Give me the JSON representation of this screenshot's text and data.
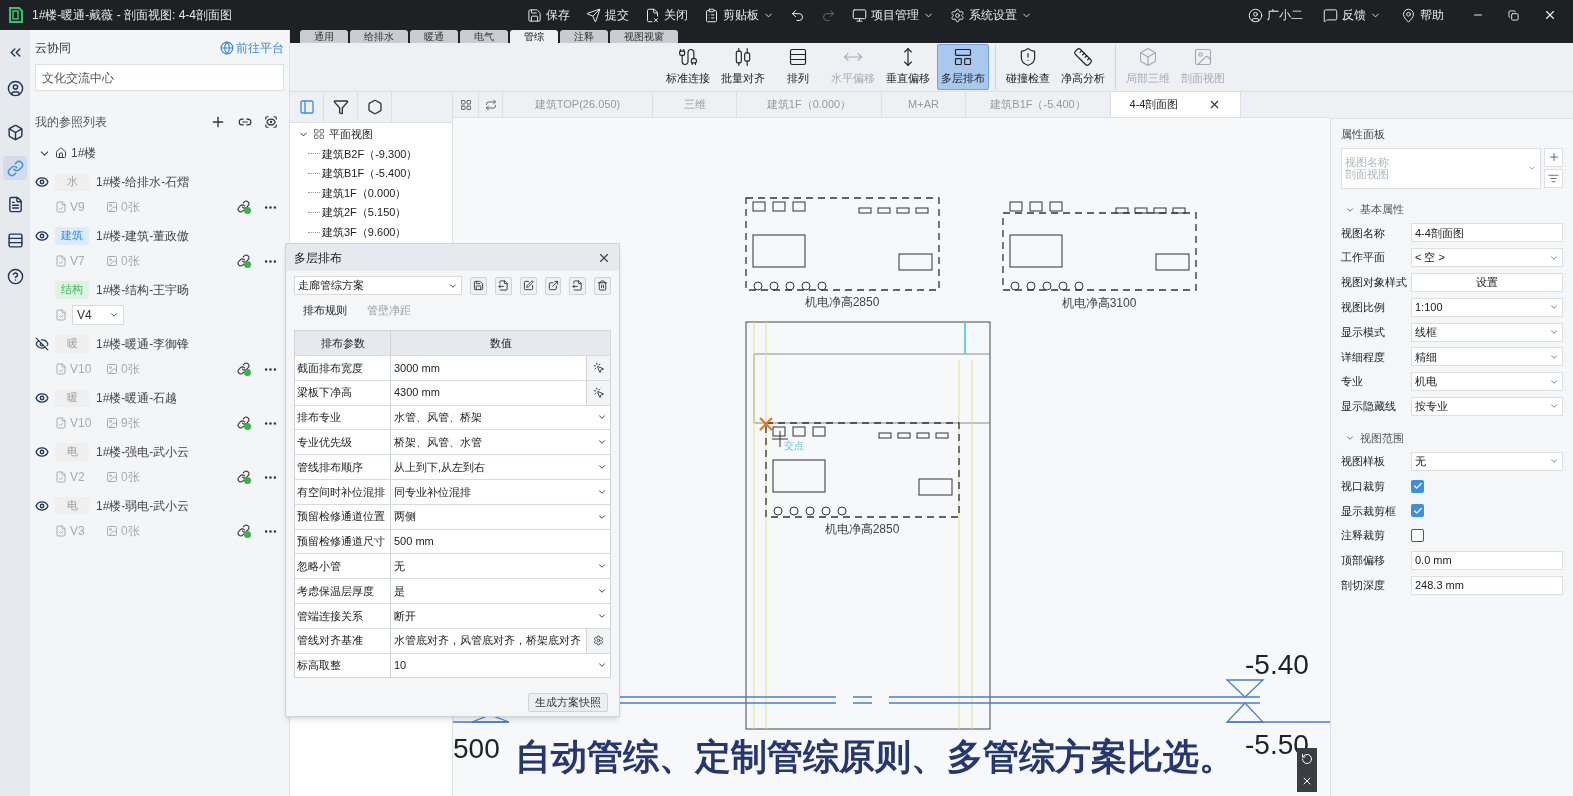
{
  "title_bar": {
    "title": "1#楼-暖通-戴薇 - 剖面视图: 4-4剖面图",
    "tools": [
      {
        "kind": "save",
        "label": "保存",
        "menu": false,
        "disabled": false
      },
      {
        "kind": "submit",
        "label": "提交",
        "menu": false,
        "disabled": false
      },
      {
        "kind": "close",
        "label": "关闭",
        "menu": false,
        "disabled": false
      },
      {
        "kind": "clipboard",
        "label": "剪贴板",
        "menu": true,
        "disabled": false
      },
      {
        "kind": "undo",
        "menu": false,
        "disabled": false
      },
      {
        "kind": "redo",
        "menu": false,
        "disabled": true
      },
      {
        "kind": "project",
        "label": "项目管理",
        "menu": true,
        "disabled": false
      },
      {
        "kind": "settings",
        "label": "系统设置",
        "menu": true,
        "disabled": false
      }
    ],
    "user_menu": [
      {
        "kind": "user",
        "label": "广小二",
        "menu": false
      },
      {
        "kind": "feedback",
        "label": "反馈",
        "menu": true
      },
      {
        "kind": "help",
        "label": "帮助",
        "menu": false
      }
    ]
  },
  "ribbon_tabs": [
    {
      "label": "通用",
      "selected": false
    },
    {
      "label": "给排水",
      "selected": false
    },
    {
      "label": "暖通",
      "selected": false
    },
    {
      "label": "电气",
      "selected": false
    },
    {
      "label": "管综",
      "selected": true
    },
    {
      "label": "注释",
      "selected": false
    },
    {
      "label": "视图视窗",
      "selected": false
    }
  ],
  "ribbon_groups": [
    [
      {
        "kind": "connect",
        "label": "标准连接",
        "selected": false,
        "disabled": false
      },
      {
        "kind": "align",
        "label": "批量对齐",
        "selected": false,
        "disabled": false
      },
      {
        "kind": "arrange",
        "label": "排列",
        "selected": false,
        "disabled": false
      },
      {
        "kind": "h_offset",
        "label": "水平偏移",
        "selected": false,
        "disabled": true
      },
      {
        "kind": "v_offset",
        "label": "垂直偏移",
        "selected": false,
        "disabled": false
      },
      {
        "kind": "multilayer",
        "label": "多层排布",
        "selected": true,
        "disabled": false
      }
    ],
    [
      {
        "kind": "clash",
        "label": "碰撞检查",
        "selected": false,
        "disabled": false
      },
      {
        "kind": "clearance",
        "label": "净高分析",
        "selected": false,
        "disabled": false
      }
    ],
    [
      {
        "kind": "local3d",
        "label": "局部三维",
        "selected": false,
        "disabled": true
      },
      {
        "kind": "section",
        "label": "剖面视图",
        "selected": false,
        "disabled": true
      }
    ]
  ],
  "rail": [
    {
      "kind": "collapse",
      "selected": false
    },
    {
      "kind": "avatar",
      "selected": false
    },
    {
      "kind": "model",
      "selected": false
    },
    {
      "kind": "link",
      "selected": true
    },
    {
      "kind": "files",
      "selected": false
    },
    {
      "kind": "list",
      "selected": false
    },
    {
      "kind": "help",
      "selected": false
    }
  ],
  "sidebar": {
    "title": "云协同",
    "link": "前往平台",
    "search": {
      "value": "文化交流中心"
    },
    "list_title": "我的参照列表",
    "tree": {
      "label": "1#楼",
      "expanded": true,
      "children": [
        {
          "kind": "linked",
          "visible": true,
          "tag": "水",
          "color": "#efefef",
          "name": "1#楼-给排水-石熠",
          "version": "V9",
          "count": "0张"
        },
        {
          "kind": "linked",
          "visible": true,
          "tag": "建筑",
          "color": "#dcecfa",
          "name": "1#楼-建筑-董政傲",
          "version": "V7",
          "count": "0张"
        },
        {
          "kind": "select",
          "tag": "结构",
          "color": "#dff3e3",
          "name": "1#楼-结构-王宇旸",
          "version": "V4"
        },
        {
          "kind": "linked",
          "visible": false,
          "tag": "暖",
          "color": "#efefef",
          "name": "1#楼-暖通-李御锋",
          "version": "V10",
          "count": "0张"
        },
        {
          "kind": "linked",
          "visible": true,
          "tag": "暖",
          "color": "#efefef",
          "name": "1#楼-暖通-石越",
          "version": "V10",
          "count": "9张"
        },
        {
          "kind": "linked",
          "visible": true,
          "tag": "电",
          "color": "#efefef",
          "name": "1#楼-强电-武小云",
          "version": "V2",
          "count": "0张"
        },
        {
          "kind": "linked",
          "visible": true,
          "tag": "电",
          "color": "#efefef",
          "name": "1#楼-弱电-武小云",
          "version": "V3",
          "count": "0张"
        }
      ]
    }
  },
  "view_tree": {
    "tools": [
      {
        "kind": "panel",
        "selected": true
      },
      {
        "kind": "filter",
        "selected": false
      },
      {
        "kind": "cube",
        "selected": false
      }
    ],
    "root": {
      "label": "平面视图",
      "expanded": true,
      "children": [
        {
          "label": "建筑B2F（-9.300）"
        },
        {
          "label": "建筑B1F（-5.400）"
        },
        {
          "label": "建筑1F（0.000）"
        },
        {
          "label": "建筑2F（5.150）"
        },
        {
          "label": "建筑3F（9.600）"
        }
      ]
    }
  },
  "view_tabs": [
    {
      "label": "建筑TOP(26.050)",
      "selected": false,
      "closable": false
    },
    {
      "label": "三维",
      "selected": false,
      "closable": false
    },
    {
      "label": "建筑1F（0.000）",
      "selected": false,
      "closable": false
    },
    {
      "label": "M+AR",
      "selected": false,
      "closable": false
    },
    {
      "label": "建筑B1F（-5.400）",
      "selected": false,
      "closable": false
    },
    {
      "label": "4-4剖面图",
      "selected": true,
      "closable": true
    }
  ],
  "canvas": {
    "box_labels": [
      "机电净高2850",
      "机电净高3100",
      "机电净高2850"
    ],
    "snap_label": "交点",
    "level_texts": [
      "-5.40",
      "-5.50",
      "500"
    ],
    "caption": "自动管综、定制管综原则、多管综方案比选。"
  },
  "dialog": {
    "title": "多层排布",
    "scheme": "走廊管综方案",
    "tabs": [
      {
        "label": "排布规则",
        "selected": true
      },
      {
        "label": "管壁净距",
        "selected": false
      }
    ],
    "columns": [
      "排布参数",
      "数值"
    ],
    "rows": [
      {
        "kind": "pick",
        "label": "截面排布宽度",
        "value": "3000 mm"
      },
      {
        "kind": "pick",
        "label": "梁板下净高",
        "value": "4300 mm"
      },
      {
        "kind": "select",
        "label": "排布专业",
        "value": "水管、风管、桥架"
      },
      {
        "kind": "select",
        "label": "专业优先级",
        "value": "桥架、风管、水管"
      },
      {
        "kind": "select",
        "label": "管线排布顺序",
        "value": "从上到下,从左到右"
      },
      {
        "kind": "select",
        "label": "有空间时补位混排",
        "value": "同专业补位混排"
      },
      {
        "kind": "select",
        "label": "预留检修通道位置",
        "value": "两侧"
      },
      {
        "kind": "input",
        "label": "预留检修通道尺寸",
        "value": "500 mm"
      },
      {
        "kind": "select",
        "label": "忽略小管",
        "value": "无"
      },
      {
        "kind": "select",
        "label": "考虑保温层厚度",
        "value": "是"
      },
      {
        "kind": "select",
        "label": "管端连接关系",
        "value": "断开"
      },
      {
        "kind": "gear",
        "label": "管线对齐基准",
        "value": "水管底对齐，风管底对齐，桥架底对齐"
      },
      {
        "kind": "select",
        "label": "标高取整",
        "value": "10"
      }
    ],
    "button": "生成方案快照"
  },
  "properties": {
    "title": "属性面板",
    "type_selector": {
      "line_1": "视图名称",
      "line_2": "剖面视图"
    },
    "sections": [
      {
        "title": "基本属性",
        "expanded": true,
        "rows": [
          {
            "kind": "input",
            "label": "视图名称",
            "value": "4-4剖面图"
          },
          {
            "kind": "select",
            "label": "工作平面",
            "value": "< 空 >"
          },
          {
            "kind": "button",
            "label": "视图对象样式",
            "value": "设置"
          },
          {
            "kind": "select",
            "label": "视图比例",
            "value": "1:100"
          },
          {
            "kind": "select",
            "label": "显示模式",
            "value": "线框"
          },
          {
            "kind": "select",
            "label": "详细程度",
            "value": "精细"
          },
          {
            "kind": "select",
            "label": "专业",
            "value": "机电"
          },
          {
            "kind": "select",
            "label": "显示隐藏线",
            "value": "按专业"
          }
        ]
      },
      {
        "title": "视图范围",
        "expanded": true,
        "rows": [
          {
            "kind": "select",
            "label": "视图样板",
            "value": "无"
          },
          {
            "kind": "checkbox",
            "label": "视口裁剪",
            "checked": true
          },
          {
            "kind": "checkbox",
            "label": "显示裁剪框",
            "checked": true
          },
          {
            "kind": "checkbox",
            "label": "注释裁剪",
            "checked": false
          },
          {
            "kind": "input",
            "label": "顶部偏移",
            "value": "0.0 mm"
          },
          {
            "kind": "input",
            "label": "剖切深度",
            "value": "248.3 mm"
          }
        ]
      }
    ]
  }
}
